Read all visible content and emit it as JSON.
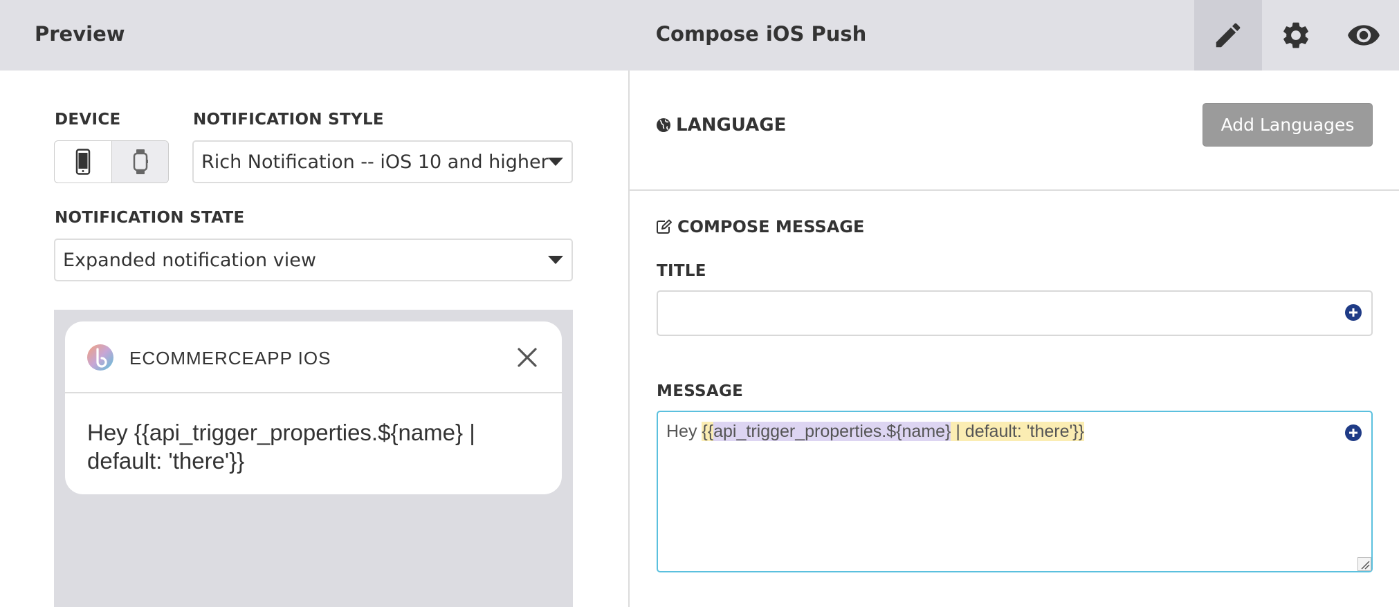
{
  "header": {
    "left_title": "Preview",
    "center_title": "Compose iOS Push",
    "buttons": [
      "pencil-icon",
      "gear-icon",
      "eye-icon"
    ],
    "active_button": "pencil-icon"
  },
  "preview": {
    "device_label": "DEVICE",
    "devices": [
      "phone-icon",
      "watch-icon"
    ],
    "selected_device": "phone-icon",
    "style_label": "NOTIFICATION STYLE",
    "style_value": "Rich Notification -- iOS 10 and higher",
    "state_label": "NOTIFICATION STATE",
    "state_value": "Expanded notification view",
    "notification": {
      "app_name": "ECOMMERCEAPP IOS",
      "body": "Hey {{api_trigger_properties.${name} | default: 'there'}}"
    }
  },
  "compose": {
    "language_label": "LANGUAGE",
    "add_languages_button": "Add Languages",
    "compose_label": "COMPOSE MESSAGE",
    "title_label": "TITLE",
    "title_value": "",
    "message_label": "MESSAGE",
    "message_parts": {
      "prefix": "Hey ",
      "open_braces": "{{",
      "property": "api_trigger_properties.${name}",
      "filter": " | default: 'there'}}"
    }
  },
  "colors": {
    "header_bg": "#e0e0e5",
    "button_gray": "#9b9b9b",
    "focus_border": "#5bc0de",
    "plus_icon": "#1f3b86",
    "highlight_yellow": "#fbedb3",
    "highlight_purple": "#ddd5f2"
  }
}
